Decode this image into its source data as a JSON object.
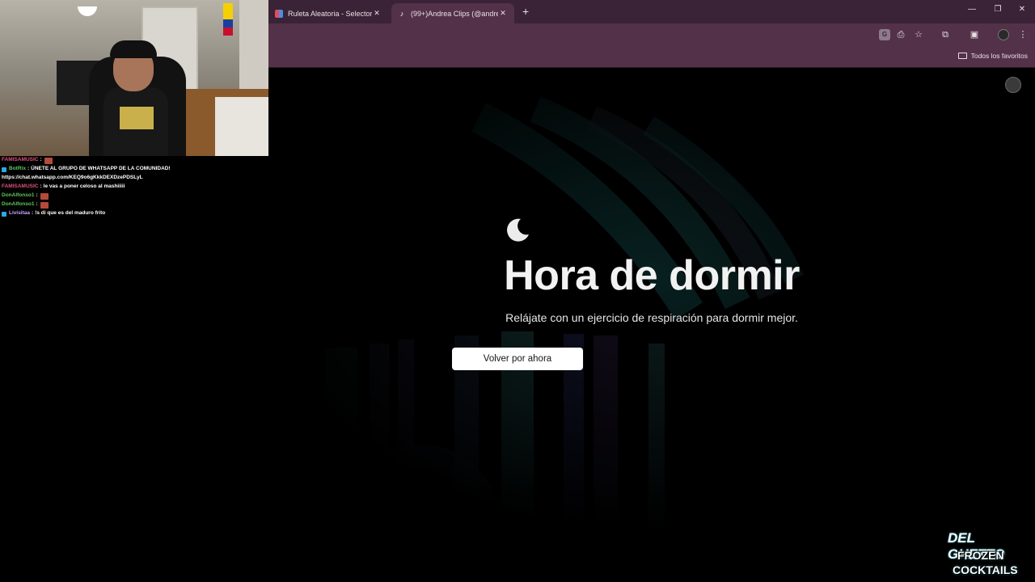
{
  "chat": {
    "lines": [
      {
        "user": "FAMISAMUSIC",
        "user_color": "#e0507a",
        "message": "",
        "emote": true,
        "badge": false
      },
      {
        "user": "BotRix",
        "user_color": "#5cc85c",
        "message": "ÚNETE AL GRUPO DE WHATSAPP DE LA COMUNIDAD!",
        "emote": false,
        "badge": true
      },
      {
        "user": "",
        "user_color": "#ffffff",
        "message": "https://chat.whatsapp.com/KEQ9o6gKkkDEXDzePDSLyL",
        "emote": false,
        "badge": false
      },
      {
        "user": "FAMISAMUSIC",
        "user_color": "#e0507a",
        "message": "le vas a poner celoso al mashiiiii",
        "emote": false,
        "badge": false
      },
      {
        "user": "DonAlfonso1",
        "user_color": "#5cc85c",
        "message": "",
        "emote": true,
        "badge": false
      },
      {
        "user": "DonAlfonso1",
        "user_color": "#5cc85c",
        "message": "",
        "emote": true,
        "badge": false
      },
      {
        "user": "Livisitaa",
        "user_color": "#c8a0ff",
        "message": "!s di que es del maduro frito",
        "emote": false,
        "badge": true
      }
    ]
  },
  "browser": {
    "tabs": [
      {
        "title": "Ruleta Aleatoria - Selector Perso",
        "active": false,
        "icon": "multicolor-wheel-icon"
      },
      {
        "title": "(99+)Andrea Clips (@andreaclip",
        "active": true,
        "icon": "tiktok-icon"
      }
    ],
    "new_tab": "+",
    "window_controls": {
      "minimize": "—",
      "restore": "❐",
      "close": "✕"
    },
    "toolbar": {
      "translate": "G",
      "install": "⎙",
      "bookmark_star": "☆",
      "extensions": "⧉",
      "side_panel": "▣",
      "menu": "⋮"
    },
    "bookmarks_bar": {
      "folder_label": "Todos los favoritos"
    }
  },
  "page": {
    "title": "Hora de dormir",
    "subtitle": "Relájate con un ejercicio de respiración para dormir mejor.",
    "button_label": "Volver por ahora"
  },
  "sponsor": {
    "line1": "DEL GHETTO",
    "line2": "FROZEN",
    "line3": "COCKTAILS"
  },
  "colors": {
    "tabbar": "#3a2336",
    "toolbar": "#533149",
    "page_bg": "#000000",
    "accent_teal": "#1aa1b8"
  }
}
